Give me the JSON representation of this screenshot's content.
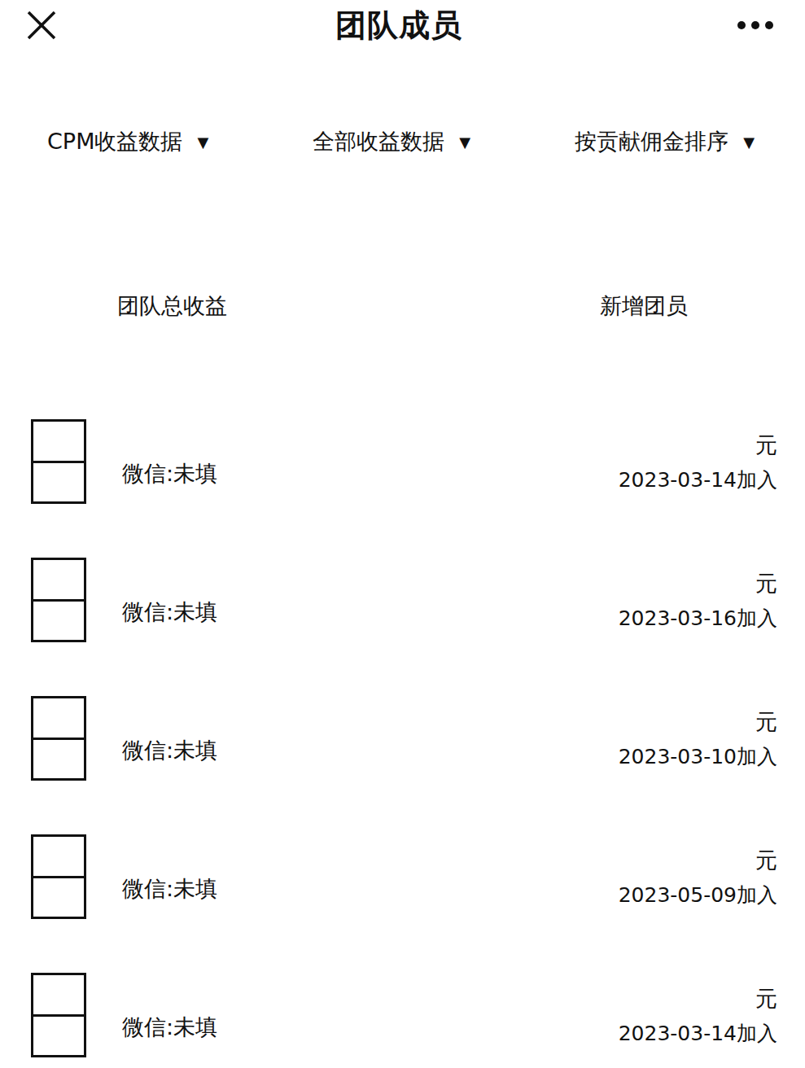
{
  "window": {
    "title": "团队成员"
  },
  "filters": [
    {
      "label": "CPM收益数据",
      "arrow": "▼"
    },
    {
      "label": "全部收益数据",
      "arrow": "▼"
    },
    {
      "label": "按贡献佣金排序",
      "arrow": "▼"
    }
  ],
  "summary": {
    "left": "团队总收益",
    "right": "新增团员"
  },
  "members": [
    {
      "wechat": "微信:未填",
      "amount": "元",
      "joined": "2023-03-14加入"
    },
    {
      "wechat": "微信:未填",
      "amount": "元",
      "joined": "2023-03-16加入"
    },
    {
      "wechat": "微信:未填",
      "amount": "元",
      "joined": "2023-03-10加入"
    },
    {
      "wechat": "微信:未填",
      "amount": "元",
      "joined": "2023-05-09加入"
    },
    {
      "wechat": "微信:未填",
      "amount": "元",
      "joined": "2023-03-14加入"
    }
  ]
}
